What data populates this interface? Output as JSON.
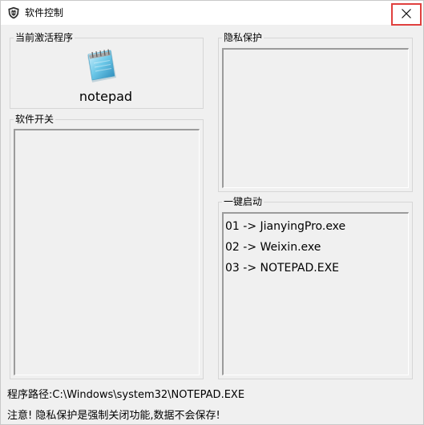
{
  "window": {
    "title": "软件控制",
    "icons": {
      "app": "app-shield-icon",
      "close": "close-icon"
    }
  },
  "current_app": {
    "group_label": "当前激活程序",
    "app_name": "notepad",
    "icon": "notepad-icon"
  },
  "privacy": {
    "group_label": "隐私保护",
    "items": []
  },
  "software_switch": {
    "group_label": "软件开关",
    "items": []
  },
  "one_click": {
    "group_label": "一键启动",
    "items": [
      {
        "text": "01 -> JianyingPro.exe"
      },
      {
        "text": "02 -> Weixin.exe"
      },
      {
        "text": "03 -> NOTEPAD.EXE"
      }
    ]
  },
  "status": {
    "path": "程序路径:C:\\Windows\\system32\\NOTEPAD.EXE",
    "notice": "注意! 隐私保护是强制关闭功能,数据不会保存!"
  }
}
